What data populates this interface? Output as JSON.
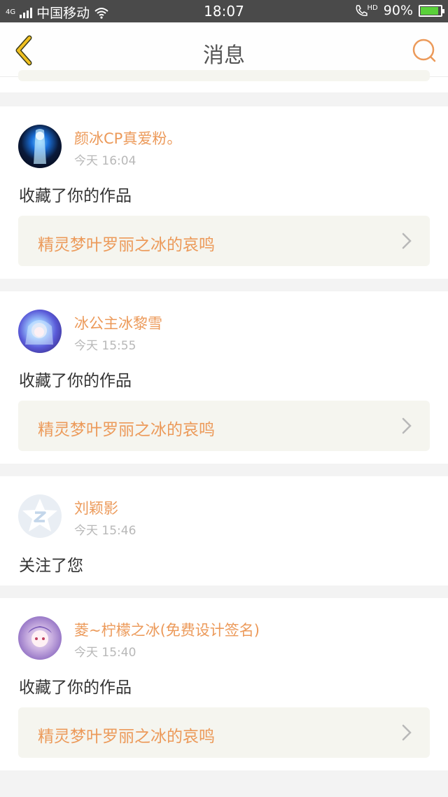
{
  "statusbar": {
    "network_tag": "4G",
    "carrier": "中国移动",
    "time": "18:07",
    "call_tag": "HD",
    "battery_percent": "90%",
    "battery_level": 0.9,
    "icons": [
      "signal-icon",
      "wifi-icon",
      "phone-hd-icon",
      "battery-icon"
    ]
  },
  "navbar": {
    "title": "消息",
    "back_icon": "chevron-left-icon",
    "search_icon": "search-icon",
    "accent": "#ec9a5a",
    "back_color": "#f0c020"
  },
  "messages": [
    {
      "user": "颜冰CP真爱粉。",
      "time": "今天 16:04",
      "action": "收藏了你的作品",
      "work": "精灵梦叶罗丽之冰的哀鸣",
      "avatar": "avatar-dark-blue"
    },
    {
      "user": "冰公主冰黎雪",
      "time": "今天 15:55",
      "action": "收藏了你的作品",
      "work": "精灵梦叶罗丽之冰的哀鸣",
      "avatar": "avatar-purple-blue"
    },
    {
      "user": "刘颖影",
      "time": "今天 15:46",
      "action": "关注了您",
      "avatar": "avatar-default-qzone"
    },
    {
      "user": "菱~柠檬之冰(免费设计签名)",
      "time": "今天 15:40",
      "action": "收藏了你的作品",
      "work": "精灵梦叶罗丽之冰的哀鸣",
      "avatar": "avatar-lavender"
    }
  ]
}
